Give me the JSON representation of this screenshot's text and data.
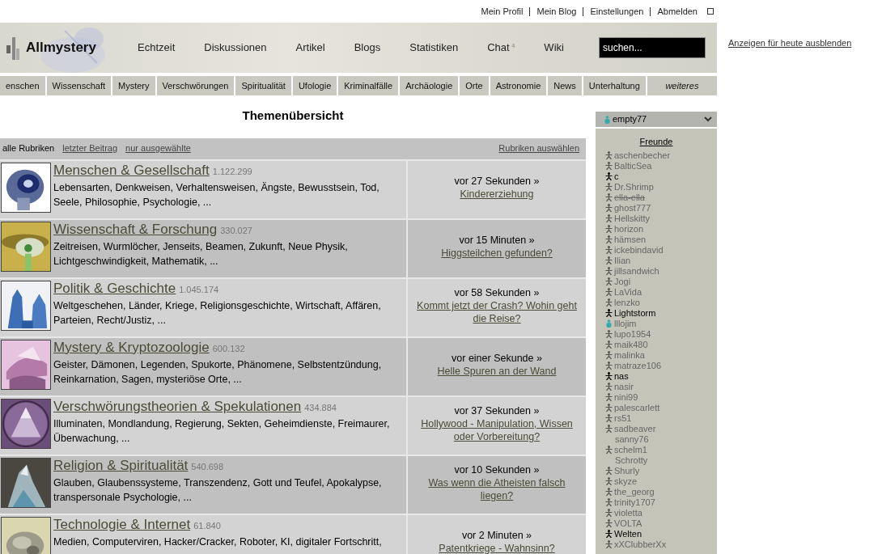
{
  "top_links": [
    "Mein Profil",
    "Mein Blog",
    "Einstellungen",
    "Abmelden"
  ],
  "logout_checkbox": {
    "checked": false
  },
  "logo": {
    "text": "Allmystery"
  },
  "main_nav": [
    {
      "label": "Echtzeit"
    },
    {
      "label": "Diskussionen"
    },
    {
      "label": "Artikel"
    },
    {
      "label": "Blogs"
    },
    {
      "label": "Statistiken"
    },
    {
      "label": "Chat",
      "badge": "4"
    },
    {
      "label": "Wiki"
    }
  ],
  "search": {
    "placeholder": "suchen..."
  },
  "ad_link": "Anzeigen für heute ausblenden",
  "categories_nav": [
    {
      "label": "enschen",
      "italic": false
    },
    {
      "label": "Wissenschaft",
      "italic": false
    },
    {
      "label": "Mystery",
      "italic": false
    },
    {
      "label": "Verschwörungen",
      "italic": false
    },
    {
      "label": "Spiritualität",
      "italic": false
    },
    {
      "label": "Ufologie",
      "italic": false
    },
    {
      "label": "Kriminalfälle",
      "italic": false
    },
    {
      "label": "Archäologie",
      "italic": false
    },
    {
      "label": "Orte",
      "italic": false
    },
    {
      "label": "Astronomie",
      "italic": false
    },
    {
      "label": "News",
      "italic": false
    },
    {
      "label": "Unterhaltung",
      "italic": false
    },
    {
      "label": "weiteres",
      "italic": true
    }
  ],
  "page_title": "Themenübersicht",
  "filters": [
    {
      "label": "alle Rubriken",
      "selected": true
    },
    {
      "label": "letzter Beitrag",
      "selected": false
    },
    {
      "label": "nur ausgewählte",
      "selected": false
    }
  ],
  "select_link": "Rubriken auswählen",
  "topics": [
    {
      "title": "Menschen & Gesellschaft",
      "count": "1.122.299",
      "description": "Lebensarten, Denkweisen, Verhaltensweisen, Ängste, Bewusstsein, Tod, Seele, Philosophie, Psychologie, ...",
      "last_time": "vor 27 Sekunden »",
      "last_thread": "Kindererziehung"
    },
    {
      "title": "Wissenschaft & Forschung",
      "count": "330.027",
      "description": "Zeitreisen, Wurmlöcher, Jenseits, Beamen, Zukunft, Neue Physik, Lichtgeschwindigkeit, Mathematik, ...",
      "last_time": "vor 15 Minuten »",
      "last_thread": "Higgsteilchen gefunden?"
    },
    {
      "title": "Politik & Geschichte",
      "count": "1.045.174",
      "description": "Weltgeschehen, Länder, Kriege, Religionsgeschichte, Wirtschaft, Affären, Parteien, Recht/Justiz, ...",
      "last_time": "vor 58 Sekunden »",
      "last_thread": "Kommt jetzt der Crash? Wohin geht die Reise?"
    },
    {
      "title": "Mystery & Kryptozoologie",
      "count": "600.132",
      "description": "Geister, Dämonen, Legenden, Spukorte, Phänomene, Selbstentzündung, Reinkarnation, Sagen, mysteriöse Orte, ...",
      "last_time": "vor einer Sekunde »",
      "last_thread": "Helle Spuren an der Wand"
    },
    {
      "title": "Verschwörungstheorien & Spekulationen",
      "count": "434.884",
      "description": "Illuminaten, Mondlandung, Regierung, Sekten, Geheimdienste, Freimaurer, Überwachung, ...",
      "last_time": "vor 37 Sekunden »",
      "last_thread": "Hollywood - Manipulation, Wissen oder Vorbereitung?"
    },
    {
      "title": "Religion & Spiritualität",
      "count": "540.698",
      "description": "Glauben, Glaubenssysteme, Transzendenz, Gott und Teufel, Apokalypse, transpersonale Psychologie, ...",
      "last_time": "vor 10 Sekunden »",
      "last_thread": "Was wenn die Atheisten falsch liegen?"
    },
    {
      "title": "Technologie & Internet",
      "count": "61.840",
      "description": "Medien, Computerviren, Hacker/Cracker, Roboter, KI, digitaler Fortschritt,",
      "last_time": "vor 2 Minuten »",
      "last_thread": "Patentkriege - Wahnsinn?"
    }
  ],
  "sidebar": {
    "user": "empty77",
    "section_title": "Freunde",
    "friends": [
      {
        "name": "aschenbecher",
        "kind": "offline",
        "struck": false
      },
      {
        "name": "BalticSea",
        "kind": "offline",
        "struck": false
      },
      {
        "name": "c",
        "kind": "online",
        "struck": false
      },
      {
        "name": "Dr.Shrimp",
        "kind": "offline",
        "struck": false
      },
      {
        "name": "ella-ella",
        "kind": "offline",
        "struck": true
      },
      {
        "name": "ghost777",
        "kind": "offline",
        "struck": false
      },
      {
        "name": "Hellskitty",
        "kind": "offline",
        "struck": false
      },
      {
        "name": "horizon",
        "kind": "offline",
        "struck": false
      },
      {
        "name": "hämsen",
        "kind": "offline",
        "struck": false
      },
      {
        "name": "ickebindavid",
        "kind": "offline",
        "struck": false
      },
      {
        "name": "Ilian",
        "kind": "offline",
        "struck": false
      },
      {
        "name": "jillsandwich",
        "kind": "offline",
        "struck": false
      },
      {
        "name": "Jogi",
        "kind": "offline",
        "struck": false
      },
      {
        "name": "LaVida",
        "kind": "offline",
        "struck": false
      },
      {
        "name": "lenzko",
        "kind": "offline",
        "struck": false
      },
      {
        "name": "Lightstorm",
        "kind": "online",
        "struck": false
      },
      {
        "name": "lllojim",
        "kind": "chat",
        "struck": false
      },
      {
        "name": "lupo1954",
        "kind": "offline",
        "struck": false
      },
      {
        "name": "maik480",
        "kind": "offline",
        "struck": false
      },
      {
        "name": "malinka",
        "kind": "offline",
        "struck": false
      },
      {
        "name": "matraze106",
        "kind": "offline",
        "struck": false
      },
      {
        "name": "nas",
        "kind": "online",
        "struck": false
      },
      {
        "name": "nasir",
        "kind": "offline",
        "struck": false
      },
      {
        "name": "nini99",
        "kind": "offline",
        "struck": false
      },
      {
        "name": "palescarlett",
        "kind": "offline",
        "struck": false
      },
      {
        "name": "rs51",
        "kind": "offline",
        "struck": false
      },
      {
        "name": "sadbeaver",
        "kind": "offline",
        "struck": false
      },
      {
        "name": "sanny76",
        "kind": "none",
        "struck": false
      },
      {
        "name": "schelm1",
        "kind": "offline",
        "struck": false
      },
      {
        "name": "Schrotty",
        "kind": "none",
        "struck": false
      },
      {
        "name": "Shurly",
        "kind": "offline",
        "struck": false
      },
      {
        "name": "skyze",
        "kind": "offline",
        "struck": false
      },
      {
        "name": "the_georg",
        "kind": "offline",
        "struck": false
      },
      {
        "name": "trinity1707",
        "kind": "offline",
        "struck": false
      },
      {
        "name": "violetta",
        "kind": "offline",
        "struck": false
      },
      {
        "name": "VOLTA",
        "kind": "offline",
        "struck": false
      },
      {
        "name": "Welten",
        "kind": "online",
        "struck": false
      },
      {
        "name": "xXClubberXx",
        "kind": "offline",
        "struck": false
      }
    ]
  }
}
